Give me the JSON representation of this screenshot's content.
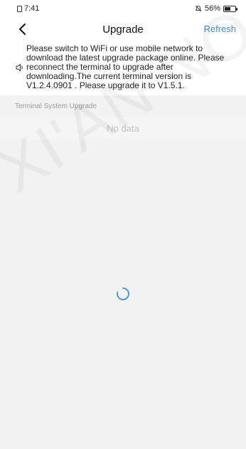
{
  "status_bar": {
    "time": "7:41",
    "battery": "56%",
    "battery_level": 0.56
  },
  "nav": {
    "title": "Upgrade",
    "refresh_label": "Refresh"
  },
  "notice": {
    "text": "Please switch to WiFi or use mobile network to download the latest upgrade package online. Please reconnect the terminal to upgrade after downloading.The current terminal version is V1.2.4.0901 . Please upgrade it to V1.5.1."
  },
  "section": {
    "header": "Terminal System Upgrade",
    "empty_text": "No data"
  },
  "watermark": "XI'AN NO",
  "colors": {
    "accent": "#3b8fe0",
    "background": "#f2f2f2"
  }
}
